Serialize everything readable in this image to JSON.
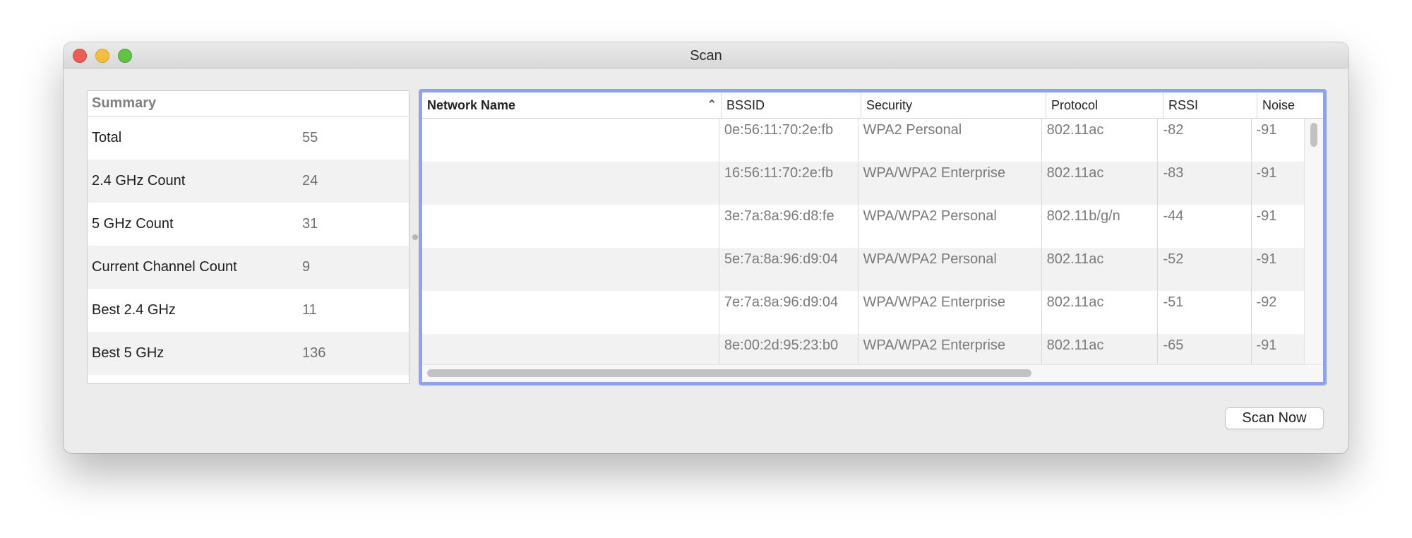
{
  "window": {
    "title": "Scan"
  },
  "summary": {
    "header": "Summary",
    "rows": [
      {
        "label": "Total",
        "value": "55"
      },
      {
        "label": "2.4 GHz Count",
        "value": "24"
      },
      {
        "label": "5 GHz Count",
        "value": "31"
      },
      {
        "label": "Current Channel Count",
        "value": "9"
      },
      {
        "label": "Best 2.4 GHz",
        "value": "11"
      },
      {
        "label": "Best 5 GHz",
        "value": "136"
      }
    ]
  },
  "networks": {
    "columns": [
      "Network Name",
      "BSSID",
      "Security",
      "Protocol",
      "RSSI",
      "Noise"
    ],
    "sort_icon": "chevron-up-icon",
    "rows": [
      {
        "name": "",
        "bssid": "0e:56:11:70:2e:fb",
        "security": "WPA2 Personal",
        "protocol": "802.11ac",
        "rssi": "-82",
        "noise": "-91"
      },
      {
        "name": "",
        "bssid": "16:56:11:70:2e:fb",
        "security": "WPA/WPA2 Enterprise",
        "protocol": "802.11ac",
        "rssi": "-83",
        "noise": "-91"
      },
      {
        "name": "",
        "bssid": "3e:7a:8a:96:d8:fe",
        "security": "WPA/WPA2 Personal",
        "protocol": "802.11b/g/n",
        "rssi": "-44",
        "noise": "-91"
      },
      {
        "name": "",
        "bssid": "5e:7a:8a:96:d9:04",
        "security": "WPA/WPA2 Personal",
        "protocol": "802.11ac",
        "rssi": "-52",
        "noise": "-91"
      },
      {
        "name": "",
        "bssid": "7e:7a:8a:96:d9:04",
        "security": "WPA/WPA2 Enterprise",
        "protocol": "802.11ac",
        "rssi": "-51",
        "noise": "-92"
      },
      {
        "name": "",
        "bssid": "8e:00:2d:95:23:b0",
        "security": "WPA/WPA2 Enterprise",
        "protocol": "802.11ac",
        "rssi": "-65",
        "noise": "-91"
      }
    ]
  },
  "actions": {
    "scan_now_label": "Scan Now"
  },
  "colors": {
    "focus_ring": "#8ea3e8",
    "close": "#ee5d55",
    "minimize": "#f5be3b",
    "zoom": "#5fc446"
  }
}
